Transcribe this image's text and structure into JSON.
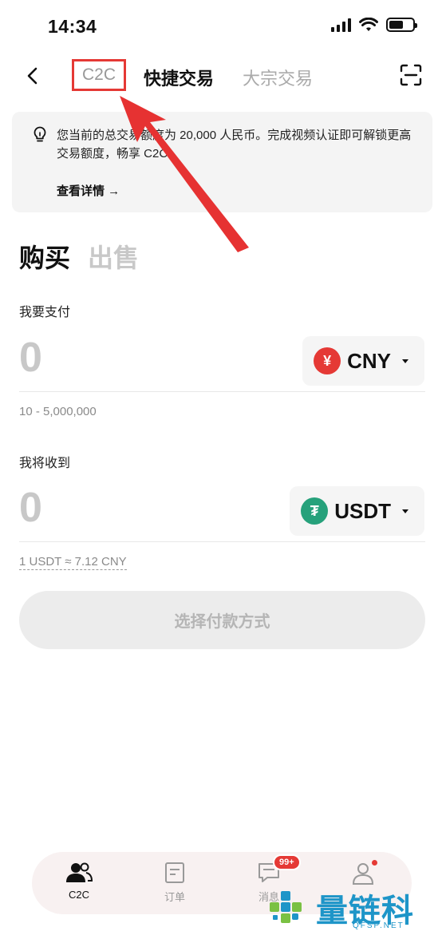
{
  "status_bar": {
    "time": "14:34"
  },
  "nav": {
    "tabs": [
      {
        "label": "C2C"
      },
      {
        "label": "快捷交易"
      },
      {
        "label": "大宗交易"
      }
    ]
  },
  "notice": {
    "text": "您当前的总交易额度为 20,000 人民币。完成视频认证即可解锁更高交易额度，畅享 C2C。",
    "link": "查看详情 →"
  },
  "trade": {
    "tabs": {
      "buy": "购买",
      "sell": "出售"
    },
    "pay": {
      "label": "我要支付",
      "amount": "0",
      "currency": "CNY",
      "currency_symbol": "¥",
      "range": "10 - 5,000,000"
    },
    "receive": {
      "label": "我将收到",
      "amount": "0",
      "currency": "USDT",
      "currency_symbol": "₮",
      "rate": "1 USDT ≈ 7.12 CNY"
    },
    "cta": "选择付款方式"
  },
  "bottom_nav": {
    "items": [
      {
        "label": "C2C",
        "icon": "users-icon"
      },
      {
        "label": "订单",
        "icon": "orders-icon"
      },
      {
        "label": "消息",
        "icon": "message-icon",
        "badge": "99+"
      },
      {
        "label": "",
        "icon": "profile-icon"
      }
    ]
  },
  "watermark": {
    "text": "量链科技",
    "url": "QFSP.NET"
  },
  "colors": {
    "highlight": "#e53935",
    "cny": "#e53935",
    "usdt": "#26a17b",
    "watermark": "#1e95c8"
  }
}
